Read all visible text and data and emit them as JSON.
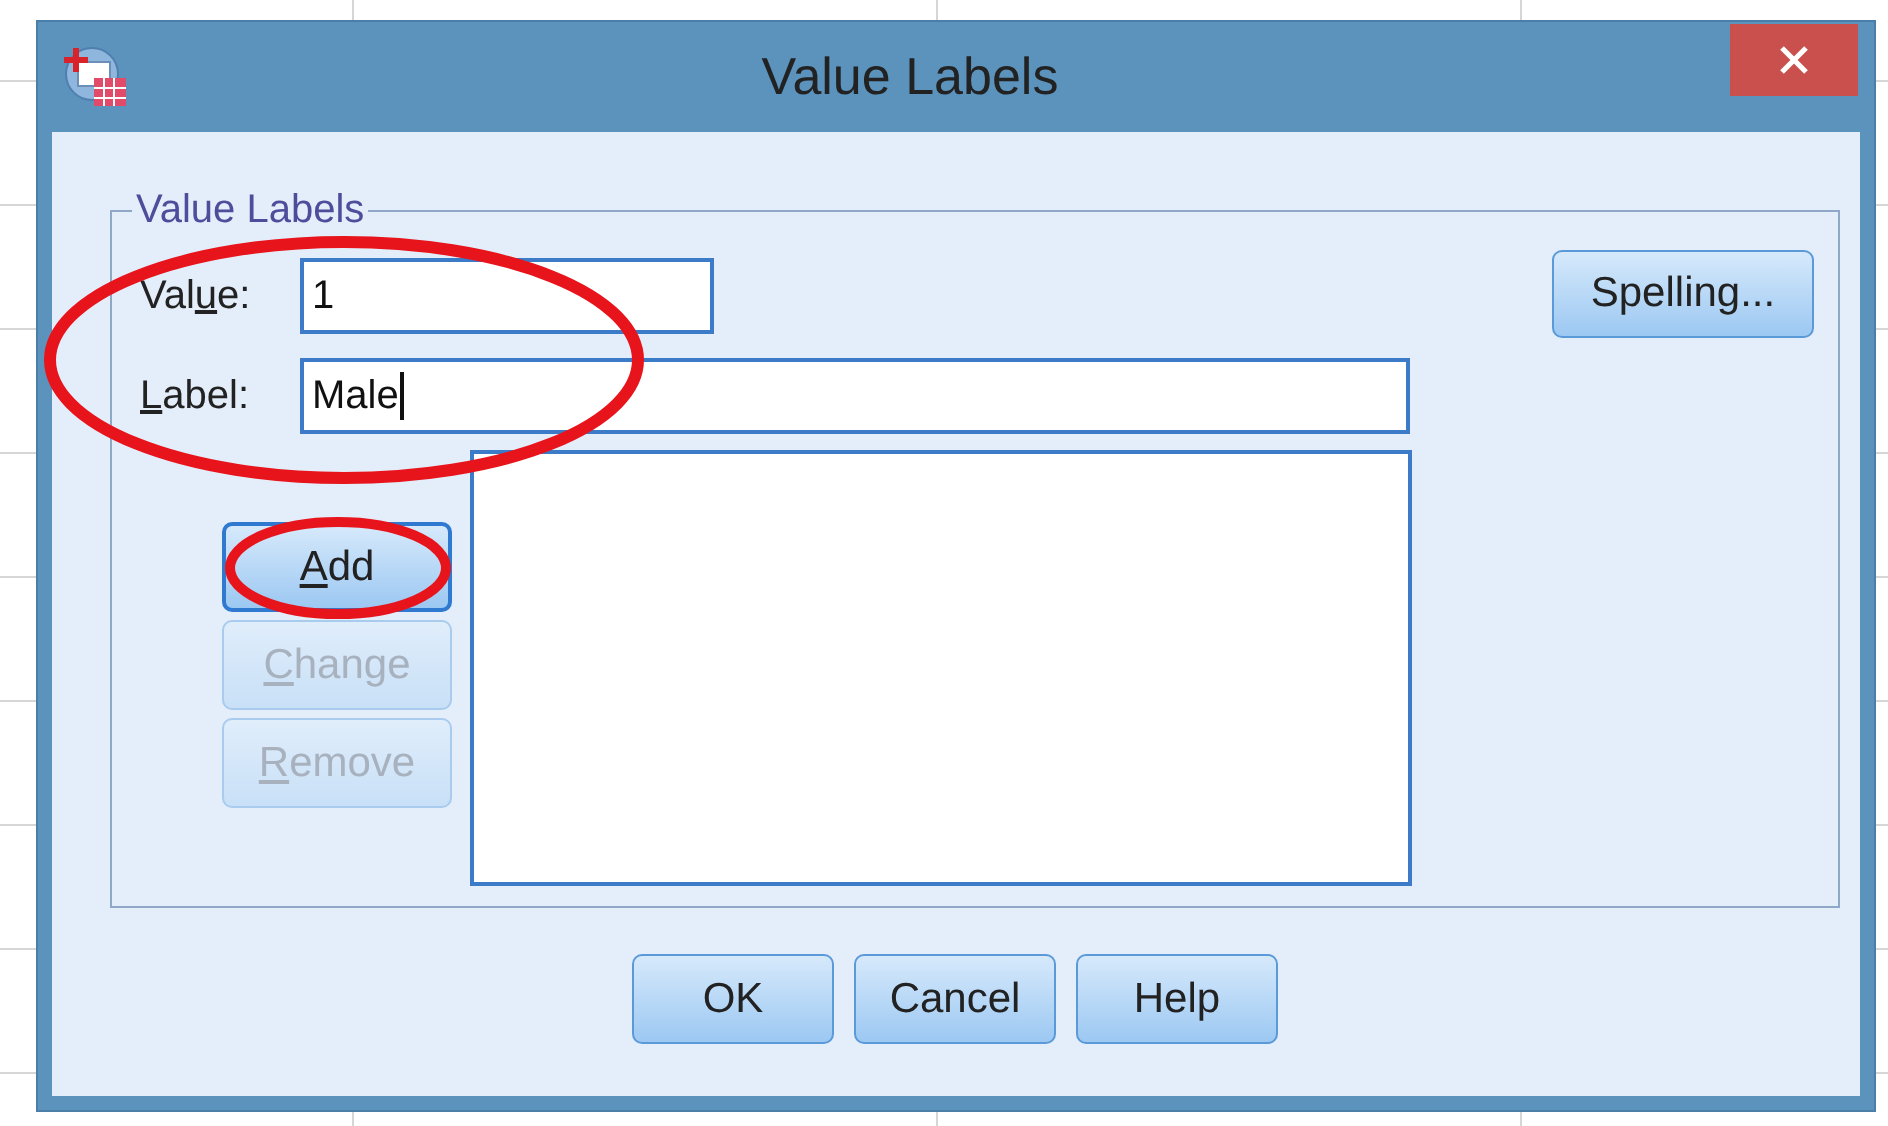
{
  "window": {
    "title": "Value Labels"
  },
  "group": {
    "title": "Value Labels"
  },
  "fields": [
    {
      "label": {
        "before": "Val",
        "key": "u",
        "after": "e:"
      },
      "value": "1",
      "kind": "short"
    },
    {
      "label": {
        "key": "L",
        "after": "abel:"
      },
      "value": "Male",
      "kind": "long"
    }
  ],
  "side_buttons": [
    {
      "label": {
        "key": "A",
        "after": "dd"
      },
      "disabled": false
    },
    {
      "label": {
        "key": "C",
        "after": "hange"
      },
      "disabled": true
    },
    {
      "label": {
        "key": "R",
        "after": "emove"
      },
      "disabled": true
    }
  ],
  "spelling_button": "Spelling...",
  "buttons": [
    "OK",
    "Cancel",
    "Help"
  ],
  "annotations": [
    {
      "kind": "ellipse"
    },
    {
      "kind": "ellipse"
    }
  ]
}
